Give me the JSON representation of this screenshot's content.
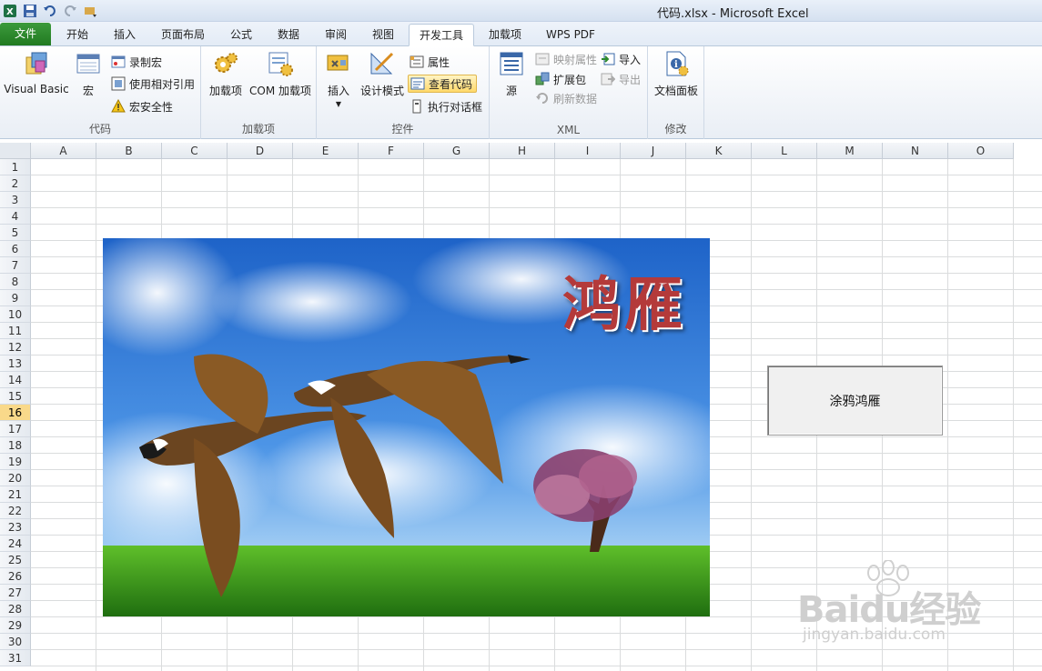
{
  "window": {
    "title": "代码.xlsx  -  Microsoft Excel"
  },
  "qat": {
    "icons": [
      "excel-logo-icon",
      "save-icon",
      "undo-icon",
      "redo-icon",
      "customize-icon"
    ]
  },
  "tabs": [
    {
      "label": "文件",
      "active": false,
      "kind": "file"
    },
    {
      "label": "开始",
      "active": false
    },
    {
      "label": "插入",
      "active": false
    },
    {
      "label": "页面布局",
      "active": false
    },
    {
      "label": "公式",
      "active": false
    },
    {
      "label": "数据",
      "active": false
    },
    {
      "label": "审阅",
      "active": false
    },
    {
      "label": "视图",
      "active": false
    },
    {
      "label": "开发工具",
      "active": true
    },
    {
      "label": "加载项",
      "active": false
    },
    {
      "label": "WPS PDF",
      "active": false
    }
  ],
  "ribbon": {
    "code": {
      "label": "代码",
      "visual_basic": "Visual Basic",
      "macros": "宏",
      "record_macro": "录制宏",
      "relative_refs": "使用相对引用",
      "macro_security": "宏安全性"
    },
    "addins": {
      "label": "加载项",
      "addins": "加载项",
      "com_addins": "COM 加载项"
    },
    "controls": {
      "label": "控件",
      "insert": "插入",
      "design_mode": "设计模式",
      "properties": "属性",
      "view_code": "查看代码",
      "run_dialog": "执行对话框"
    },
    "xml": {
      "label": "XML",
      "source": "源",
      "map_properties": "映射属性",
      "expansion_packs": "扩展包",
      "refresh_data": "刷新数据",
      "import": "导入",
      "export": "导出"
    },
    "modify": {
      "label": "修改",
      "document_panel": "文档面板"
    }
  },
  "sheet": {
    "columns": [
      "A",
      "B",
      "C",
      "D",
      "E",
      "F",
      "G",
      "H",
      "I",
      "J",
      "K",
      "L",
      "M",
      "N",
      "O"
    ],
    "rows": [
      "1",
      "2",
      "3",
      "4",
      "5",
      "6",
      "7",
      "8",
      "9",
      "10",
      "11",
      "12",
      "13",
      "14",
      "15",
      "16",
      "17",
      "18",
      "19",
      "20",
      "21",
      "22",
      "23",
      "24",
      "25",
      "26",
      "27",
      "28",
      "29",
      "30",
      "31"
    ],
    "selected_row": "16"
  },
  "picture": {
    "title_text": "鸿雁"
  },
  "form_button": {
    "label": "涂鸦鸿雁"
  },
  "watermark": {
    "brand": "Baidu经验",
    "url": "jingyan.baidu.com"
  }
}
